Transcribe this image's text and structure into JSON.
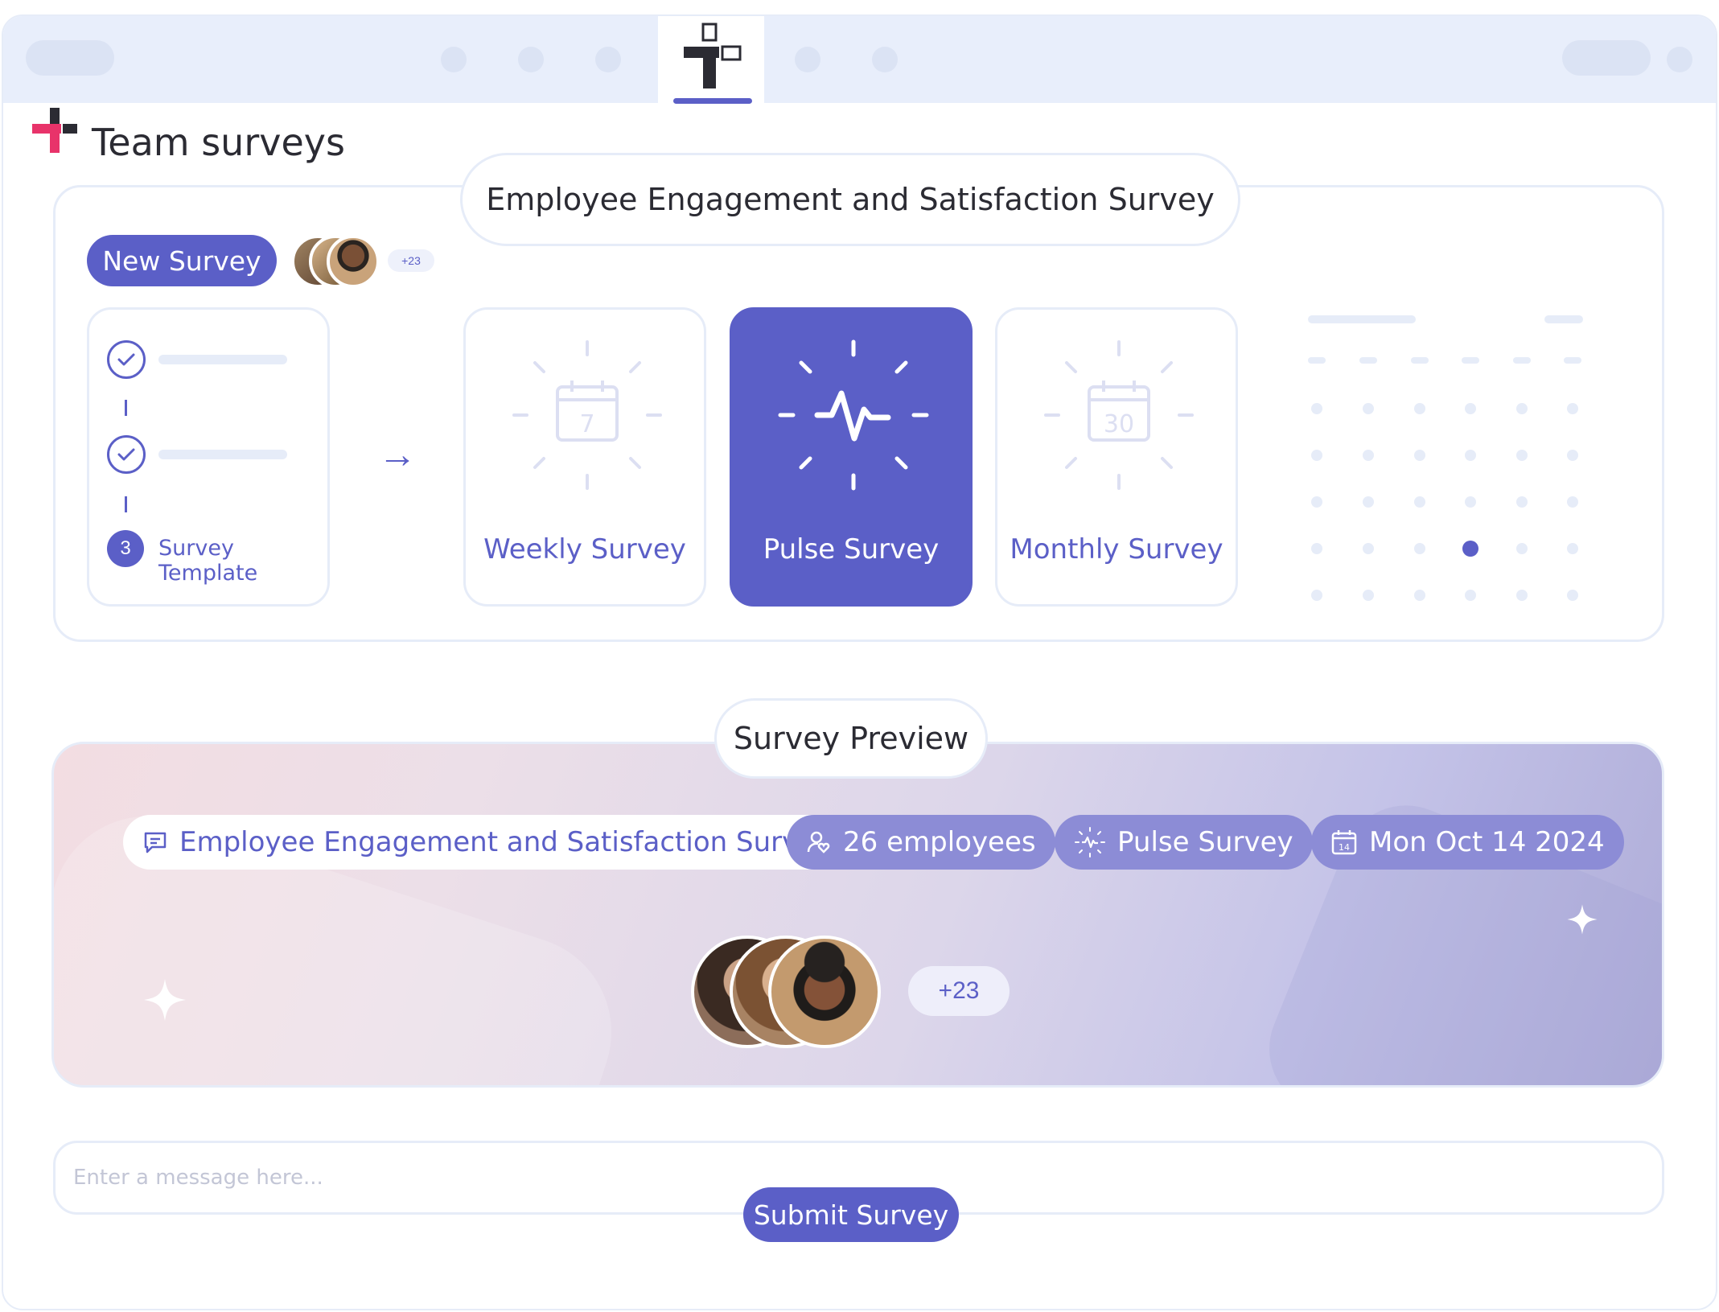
{
  "app": {
    "title": "Team surveys",
    "colors": {
      "accent": "#5b5fc7",
      "brand_red": "#e8336a",
      "brand_dark": "#2b2b33",
      "border": "#e6ecf8"
    }
  },
  "builder": {
    "survey_title": "Employee Engagement and Satisfaction Survey",
    "new_survey_label": "New Survey",
    "participants_more": "+23",
    "template": {
      "step_number": "3",
      "label": "Survey Template"
    },
    "types": [
      {
        "label": "Weekly Survey",
        "icon": "calendar-7-icon",
        "calendar_day": "7",
        "selected": false
      },
      {
        "label": "Pulse Survey",
        "icon": "pulse-icon",
        "selected": true
      },
      {
        "label": "Monthly Survey",
        "icon": "calendar-30-icon",
        "calendar_day": "30",
        "selected": false
      }
    ]
  },
  "preview": {
    "heading": "Survey Preview",
    "chips": {
      "title": "Employee Engagement and Satisfaction Survey",
      "employees": "26 employees",
      "type": "Pulse Survey",
      "date": "Mon Oct 14 2024",
      "date_icon_day": "14"
    },
    "participants_more": "+23"
  },
  "message": {
    "placeholder": "Enter a message here...",
    "value": ""
  },
  "submit_label": "Submit Survey"
}
